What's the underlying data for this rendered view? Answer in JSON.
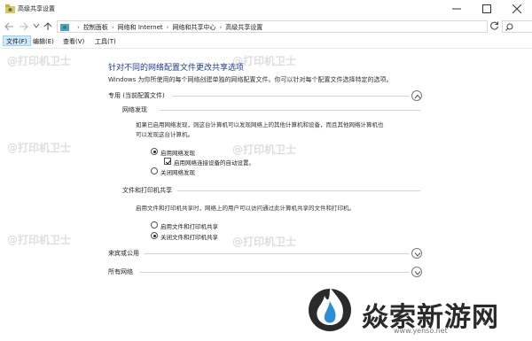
{
  "window": {
    "title": "高级共享设置",
    "icon": "network-folder-icon"
  },
  "address": {
    "crumbs": [
      "控制面板",
      "网络和 Internet",
      "网络和共享中心",
      "高级共享设置"
    ]
  },
  "menu": {
    "file": "文件(F)",
    "edit": "编辑(E)",
    "view": "查看(V)",
    "tools": "工具(T)"
  },
  "main": {
    "heading": "针对不同的网络配置文件更改共享选项",
    "description": "Windows 为你所使用的每个网络创建单独的网络配置文件。你可以针对每个配置文件选择特定的选项。",
    "private": {
      "label": "专用 (当前配置文件)",
      "discovery": {
        "title": "网络发现",
        "text_line1": "如果已启用网络发现，则这台计算机可以发现网络上的其他计算机和设备，而且其他网络计算机也",
        "text_line2": "可以发现这台计算机。",
        "turn_on": "启用网络发现",
        "auto_setup": "启用网络连接设备的自动设置。",
        "turn_off": "关闭网络发现"
      },
      "sharing": {
        "title": "文件和打印机共享",
        "text": "启用文件和打印机共享时，网络上的用户可以访问通过此计算机共享的文件和打印机。",
        "turn_on": "启用文件和打印机共享",
        "turn_off": "关闭文件和打印机共享"
      }
    },
    "guest": {
      "label": "来宾或公用"
    },
    "all": {
      "label": "所有网络"
    }
  },
  "watermark": {
    "text": "@打印机卫士"
  },
  "brand": {
    "text": "焱索新游网",
    "url": "www.yenso.net"
  },
  "colors": {
    "heading": "#1e3d8f",
    "accent": "#0078d7",
    "menu_highlight": "#cde8ff"
  }
}
